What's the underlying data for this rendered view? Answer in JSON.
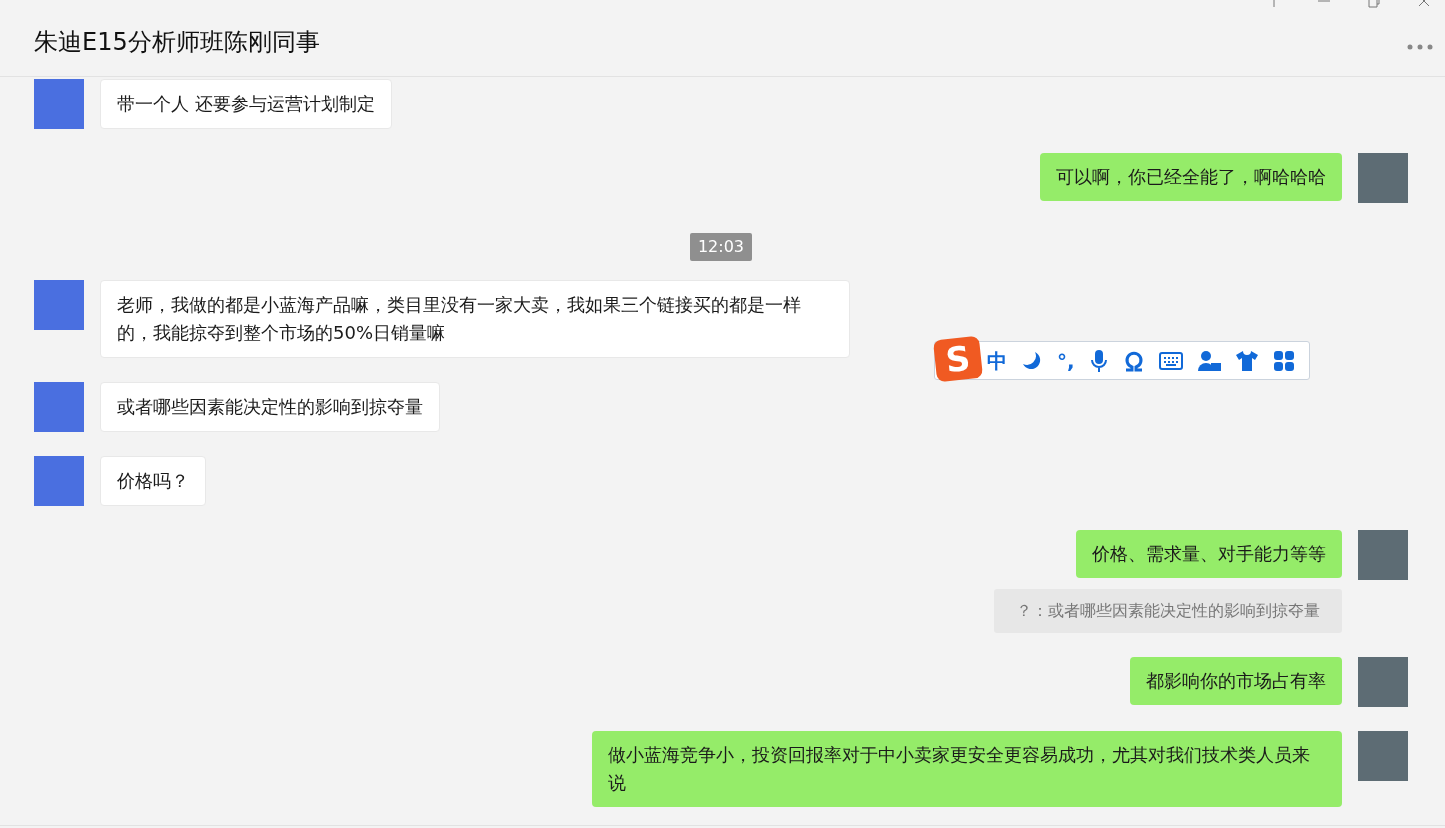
{
  "window": {
    "title": "朱迪E15分析师班陈刚同事"
  },
  "messages": [
    {
      "kind": "left",
      "text": "带一个人 还要参与运营计划制定"
    },
    {
      "kind": "right",
      "text": "可以啊，你已经全能了，啊哈哈哈"
    },
    {
      "kind": "time",
      "text": "12:03"
    },
    {
      "kind": "left",
      "text": "老师，我做的都是小蓝海产品嘛，类目里没有一家大卖，我如果三个链接买的都是一样的，我能掠夺到整个市场的50%日销量嘛"
    },
    {
      "kind": "left",
      "text": "或者哪些因素能决定性的影响到掠夺量"
    },
    {
      "kind": "left",
      "text": "价格吗？"
    },
    {
      "kind": "right",
      "text": "价格、需求量、对手能力等等"
    },
    {
      "kind": "quote",
      "text": "？：或者哪些因素能决定性的影响到掠夺量"
    },
    {
      "kind": "right",
      "text": "都影响你的市场占有率"
    },
    {
      "kind": "right",
      "text": "做小蓝海竞争小，投资回报率对于中小卖家更安全更容易成功，尤其对我们技术类人员来说"
    }
  ],
  "ime_toolbar": {
    "logo": "S",
    "mode": "中",
    "punctuation": "°,"
  }
}
